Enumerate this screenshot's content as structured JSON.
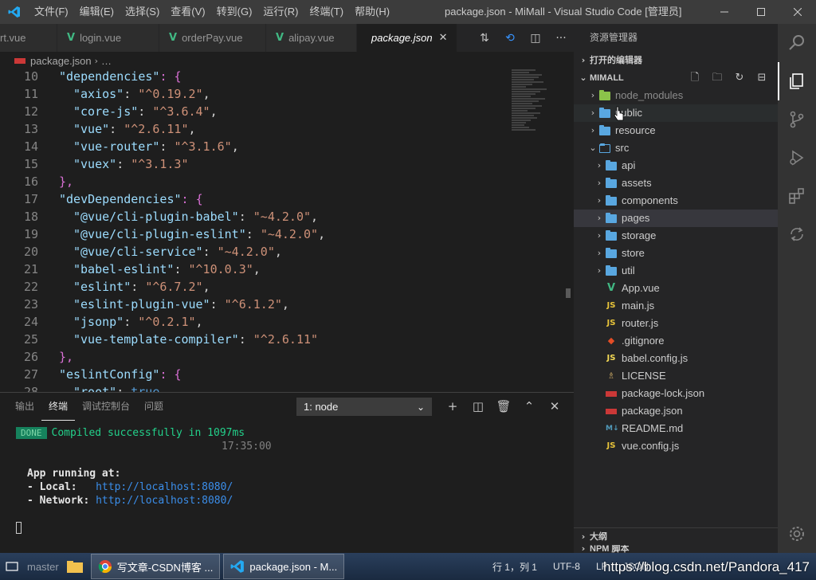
{
  "titlebar": {
    "menu": [
      "文件(F)",
      "编辑(E)",
      "选择(S)",
      "查看(V)",
      "转到(G)",
      "运行(R)",
      "终端(T)",
      "帮助(H)"
    ],
    "title": "package.json - MiMall - Visual Studio Code [管理员]"
  },
  "tabs": [
    {
      "label": "rt.vue",
      "icon": "none",
      "active": false
    },
    {
      "label": "login.vue",
      "icon": "vue-icon",
      "active": false
    },
    {
      "label": "orderPay.vue",
      "icon": "vue-icon",
      "active": false
    },
    {
      "label": "alipay.vue",
      "icon": "vue-icon",
      "active": false
    },
    {
      "label": "package.json",
      "icon": "npm-icon",
      "active": true
    }
  ],
  "breadcrumb": {
    "file": "package.json",
    "rest": "…"
  },
  "code_lines": [
    {
      "n": "10",
      "indent": 2,
      "key": "\"dependencies\"",
      "rest": ": {",
      "bracket": true
    },
    {
      "n": "11",
      "indent": 4,
      "key": "\"axios\"",
      "val": "\"^0.19.2\"",
      "end": ","
    },
    {
      "n": "12",
      "indent": 4,
      "key": "\"core-js\"",
      "val": "\"^3.6.4\"",
      "end": ","
    },
    {
      "n": "13",
      "indent": 4,
      "key": "\"vue\"",
      "val": "\"^2.6.11\"",
      "end": ","
    },
    {
      "n": "14",
      "indent": 4,
      "key": "\"vue-router\"",
      "val": "\"^3.1.6\"",
      "end": ","
    },
    {
      "n": "15",
      "indent": 4,
      "key": "\"vuex\"",
      "val": "\"^3.1.3\"",
      "end": ""
    },
    {
      "n": "16",
      "indent": 2,
      "close": "},"
    },
    {
      "n": "17",
      "indent": 2,
      "key": "\"devDependencies\"",
      "rest": ": {",
      "bracket": true
    },
    {
      "n": "18",
      "indent": 4,
      "key": "\"@vue/cli-plugin-babel\"",
      "val": "\"~4.2.0\"",
      "end": ","
    },
    {
      "n": "19",
      "indent": 4,
      "key": "\"@vue/cli-plugin-eslint\"",
      "val": "\"~4.2.0\"",
      "end": ","
    },
    {
      "n": "20",
      "indent": 4,
      "key": "\"@vue/cli-service\"",
      "val": "\"~4.2.0\"",
      "end": ","
    },
    {
      "n": "21",
      "indent": 4,
      "key": "\"babel-eslint\"",
      "val": "\"^10.0.3\"",
      "end": ","
    },
    {
      "n": "22",
      "indent": 4,
      "key": "\"eslint\"",
      "val": "\"^6.7.2\"",
      "end": ","
    },
    {
      "n": "23",
      "indent": 4,
      "key": "\"eslint-plugin-vue\"",
      "val": "\"^6.1.2\"",
      "end": ","
    },
    {
      "n": "24",
      "indent": 4,
      "key": "\"jsonp\"",
      "val": "\"^0.2.1\"",
      "end": ","
    },
    {
      "n": "25",
      "indent": 4,
      "key": "\"vue-template-compiler\"",
      "val": "\"^2.6.11\"",
      "end": ""
    },
    {
      "n": "26",
      "indent": 2,
      "close": "},"
    },
    {
      "n": "27",
      "indent": 2,
      "key": "\"eslintConfig\"",
      "rest": ": {",
      "bracket": true
    },
    {
      "n": "28",
      "indent": 4,
      "key": "\"root\"",
      "val": "true",
      "end": ",",
      "kw": true
    }
  ],
  "panel": {
    "tabs": [
      "输出",
      "终端",
      "调试控制台",
      "问题"
    ],
    "active_tab": "终端",
    "terminal_select": "1: node",
    "done_badge": "DONE",
    "compiled": "Compiled successfully in 1097ms",
    "time": "17:35:00",
    "app_running": "App running at:",
    "local_label": "- Local:   ",
    "local_url": "http://localhost:8080/",
    "network_label": "- Network: ",
    "network_url": "http://localhost:8080/"
  },
  "sidebar": {
    "header": "资源管理器",
    "open_editors": "打开的编辑器",
    "project": "MIMALL",
    "tree": [
      {
        "label": "node_modules",
        "type": "folder-nm",
        "depth": 0,
        "chev": "›",
        "dim": true
      },
      {
        "label": "public",
        "type": "folder",
        "depth": 0,
        "chev": "›",
        "hover": true
      },
      {
        "label": "resource",
        "type": "folder",
        "depth": 0,
        "chev": "›"
      },
      {
        "label": "src",
        "type": "folder-open",
        "depth": 0,
        "chev": "⌄"
      },
      {
        "label": "api",
        "type": "folder",
        "depth": 1,
        "chev": "›"
      },
      {
        "label": "assets",
        "type": "folder",
        "depth": 1,
        "chev": "›"
      },
      {
        "label": "components",
        "type": "folder",
        "depth": 1,
        "chev": "›"
      },
      {
        "label": "pages",
        "type": "folder",
        "depth": 1,
        "chev": "›",
        "selected": true
      },
      {
        "label": "storage",
        "type": "folder",
        "depth": 1,
        "chev": "›"
      },
      {
        "label": "store",
        "type": "folder",
        "depth": 1,
        "chev": "›"
      },
      {
        "label": "util",
        "type": "folder",
        "depth": 1,
        "chev": "›"
      },
      {
        "label": "App.vue",
        "type": "vue",
        "depth": 1
      },
      {
        "label": "main.js",
        "type": "js",
        "depth": 1
      },
      {
        "label": "router.js",
        "type": "js",
        "depth": 1
      },
      {
        "label": ".gitignore",
        "type": "git",
        "depth": 0
      },
      {
        "label": "babel.config.js",
        "type": "babel",
        "depth": 0
      },
      {
        "label": "LICENSE",
        "type": "license",
        "depth": 0
      },
      {
        "label": "package-lock.json",
        "type": "npm",
        "depth": 0
      },
      {
        "label": "package.json",
        "type": "npm",
        "depth": 0
      },
      {
        "label": "README.md",
        "type": "md",
        "depth": 0
      },
      {
        "label": "vue.config.js",
        "type": "js",
        "depth": 0
      }
    ],
    "outline": "大纲",
    "npm_scripts": "NPM 脚本"
  },
  "taskbar": {
    "items": [
      "写文章-CSDN博客 ...",
      "package.json - M..."
    ],
    "status_left": "master",
    "status_right": [
      "行 1，列 1",
      "UTF-8",
      "LF",
      "JSON"
    ]
  },
  "watermark": "https://blog.csdn.net/Pandora_417",
  "colors": {
    "accent": "#007acc",
    "folder": "#59a7e0",
    "vue": "#41b883",
    "js": "#e8c43a",
    "npm": "#cb3837"
  }
}
